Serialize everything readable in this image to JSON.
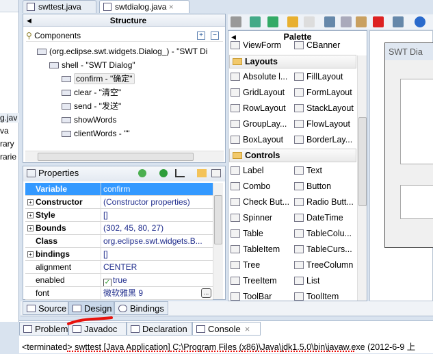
{
  "left_items": [
    "g.jav",
    "va",
    "rary",
    "rarie"
  ],
  "editor_tabs": [
    {
      "label": "swttest.java"
    },
    {
      "label": "swtdialog.java",
      "close": "×"
    }
  ],
  "structure": {
    "title": "Structure",
    "components_label": "Components",
    "tree": [
      {
        "label": "(org.eclipse.swt.widgets.Dialog_) - \"SWT Di",
        "icon": "dialog-icon",
        "depth": 0
      },
      {
        "label": "shell - \"SWT Dialog\"",
        "icon": "shell-icon",
        "depth": 1
      },
      {
        "label": "confirm - \"确定\"",
        "icon": "button-icon",
        "depth": 2,
        "selected": true
      },
      {
        "label": "clear - \"清空\"",
        "icon": "button-icon",
        "depth": 2
      },
      {
        "label": "send - \"发送\"",
        "icon": "button-icon",
        "depth": 2
      },
      {
        "label": "showWords",
        "icon": "text-icon",
        "depth": 2
      },
      {
        "label": "clientWords - \"\"",
        "icon": "text-icon",
        "depth": 2
      }
    ]
  },
  "properties": {
    "title": "Properties",
    "rows": [
      {
        "key": "Variable",
        "value": "confirm",
        "bold": true,
        "highlight": true
      },
      {
        "key": "Constructor",
        "value": "(Constructor properties)",
        "bold": true,
        "expand": true
      },
      {
        "key": "Style",
        "value": "[]",
        "bold": true,
        "expand": true
      },
      {
        "key": "Bounds",
        "value": "(302, 45, 80, 27)",
        "bold": true,
        "expand": true
      },
      {
        "key": "Class",
        "value": "org.eclipse.swt.widgets.B...",
        "bold": true
      },
      {
        "key": "bindings",
        "value": "[]",
        "bold": true,
        "expand": true
      },
      {
        "key": "alignment",
        "value": "CENTER"
      },
      {
        "key": "enabled",
        "value": "true",
        "checkbox": true
      },
      {
        "key": "font",
        "value": "微软雅黑 9",
        "ellipsis": "..."
      }
    ]
  },
  "editor_mode_tabs": [
    {
      "label": "Source"
    },
    {
      "label": "Design",
      "active": true
    },
    {
      "label": "Bindings"
    }
  ],
  "palette": {
    "title": "Palette",
    "top_items": [
      "ViewForm",
      "CBanner"
    ],
    "categories": [
      {
        "name": "Layouts",
        "items": [
          "Absolute l...",
          "FillLayout",
          "GridLayout",
          "FormLayout",
          "RowLayout",
          "StackLayout",
          "GroupLay...",
          "FlowLayout",
          "BoxLayout",
          "BorderLay..."
        ]
      },
      {
        "name": "Controls",
        "items": [
          "Label",
          "Text",
          "Combo",
          "Button",
          "Check But...",
          "Radio Butt...",
          "Spinner",
          "DateTime",
          "Table",
          "TableColu...",
          "TableItem",
          "TableCurs...",
          "Tree",
          "TreeColumn",
          "TreeItem",
          "List",
          "ToolBar",
          "ToolItem"
        ]
      }
    ]
  },
  "canvas": {
    "dialog_title": "SWT Dia"
  },
  "bottom_views": [
    {
      "label": "Problems"
    },
    {
      "label": "Javadoc"
    },
    {
      "label": "Declaration"
    },
    {
      "label": "Console",
      "active": true,
      "close": "×"
    }
  ],
  "console": {
    "line": "<terminated> swttest [Java Application] C:\\Program Files (x86)\\Java\\jdk1.5.0\\bin\\javaw.exe (2012-6-9 上"
  },
  "colors": {
    "selection": "#3399ff",
    "annotation": "#e8120c",
    "value_text": "#1f2c8c"
  }
}
